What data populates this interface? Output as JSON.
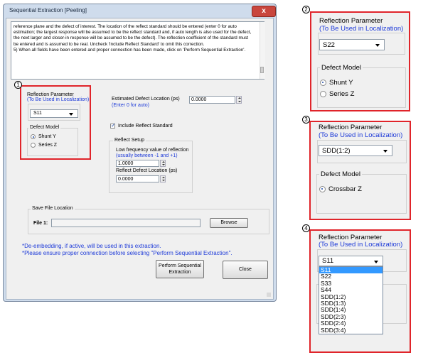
{
  "dialog": {
    "title": "Sequential Extraction [Peeling]",
    "close_glyph": "x",
    "instructions": "reference plane and the defect of interest.  The location of the reflect standard should be entered (enter 0 for auto estimation; the largest response will be assumed to be the reflect standard and, if auto length is also used for the defect, the next larger and closer-in response will be assumed to be the defect).  The reflection coefficient of the standard must be entered and is assumed to be real.  Uncheck 'Include Reflect Standard' to omit this correction.\n5) When all fields have been entered and proper connection has been made, click on 'Perform Sequential Extraction'.",
    "reflection_parameter": {
      "label": "Reflection Parameter",
      "sublabel": "(To Be Used in Localization)",
      "value": "S11"
    },
    "defect_model": {
      "label": "Defect Model",
      "options": [
        "Shunt Y",
        "Series Z"
      ],
      "selected": "Shunt Y"
    },
    "estimated_defect": {
      "label": "Estimated Defect Location (ps)",
      "hint": "(Enter 0 for auto)",
      "value": "0.0000"
    },
    "include_reflect": {
      "label": "Include Reflect Standard",
      "checked": true
    },
    "reflect_setup": {
      "label": "Reflect Setup",
      "lf_label": "Low frequency value of reflection",
      "lf_hint": "(usually between -1 and +1)",
      "lf_value": "1.0000",
      "loc_label": "Reflect Defect Location (ps)",
      "loc_value": "0.0000"
    },
    "save_file": {
      "label": "Save File Location",
      "file_label": "File 1:",
      "value": "",
      "browse_label": "Browse"
    },
    "notes": [
      "*De-embedding, if active, will be used in this extraction.",
      "*Please ensure proper connection before selecting \"Perform Sequential Extraction\"."
    ],
    "perform_label": "Perform Sequential Extraction",
    "close_label": "Close"
  },
  "callouts": [
    "1",
    "2",
    "3",
    "4"
  ],
  "panel2": {
    "param_label": "Reflection Parameter",
    "param_sublabel": "(To Be Used in Localization)",
    "param_value": "S22",
    "defect_label": "Defect Model",
    "options": [
      "Shunt Y",
      "Series Z"
    ],
    "selected": "Shunt Y"
  },
  "panel3": {
    "param_label": "Reflection Parameter",
    "param_sublabel": "(To Be Used in Localization)",
    "param_value": "SDD(1:2)",
    "defect_label": "Defect Model",
    "options": [
      "Crossbar Z"
    ],
    "selected": "Crossbar Z"
  },
  "panel4": {
    "param_label": "Reflection Parameter",
    "param_sublabel": "(To Be Used in Localization)",
    "param_value": "S11",
    "dropdown_items": [
      "S11",
      "S22",
      "S33",
      "S44",
      "SDD(1:2)",
      "SDD(1:3)",
      "SDD(1:4)",
      "SDD(2:3)",
      "SDD(2:4)",
      "SDD(3:4)"
    ],
    "highlighted": "S11"
  },
  "colors": {
    "accent_blue": "#1d3ad8",
    "note_red": "#d0011b",
    "callout_red": "#e0242a",
    "selection": "#3399ff"
  }
}
